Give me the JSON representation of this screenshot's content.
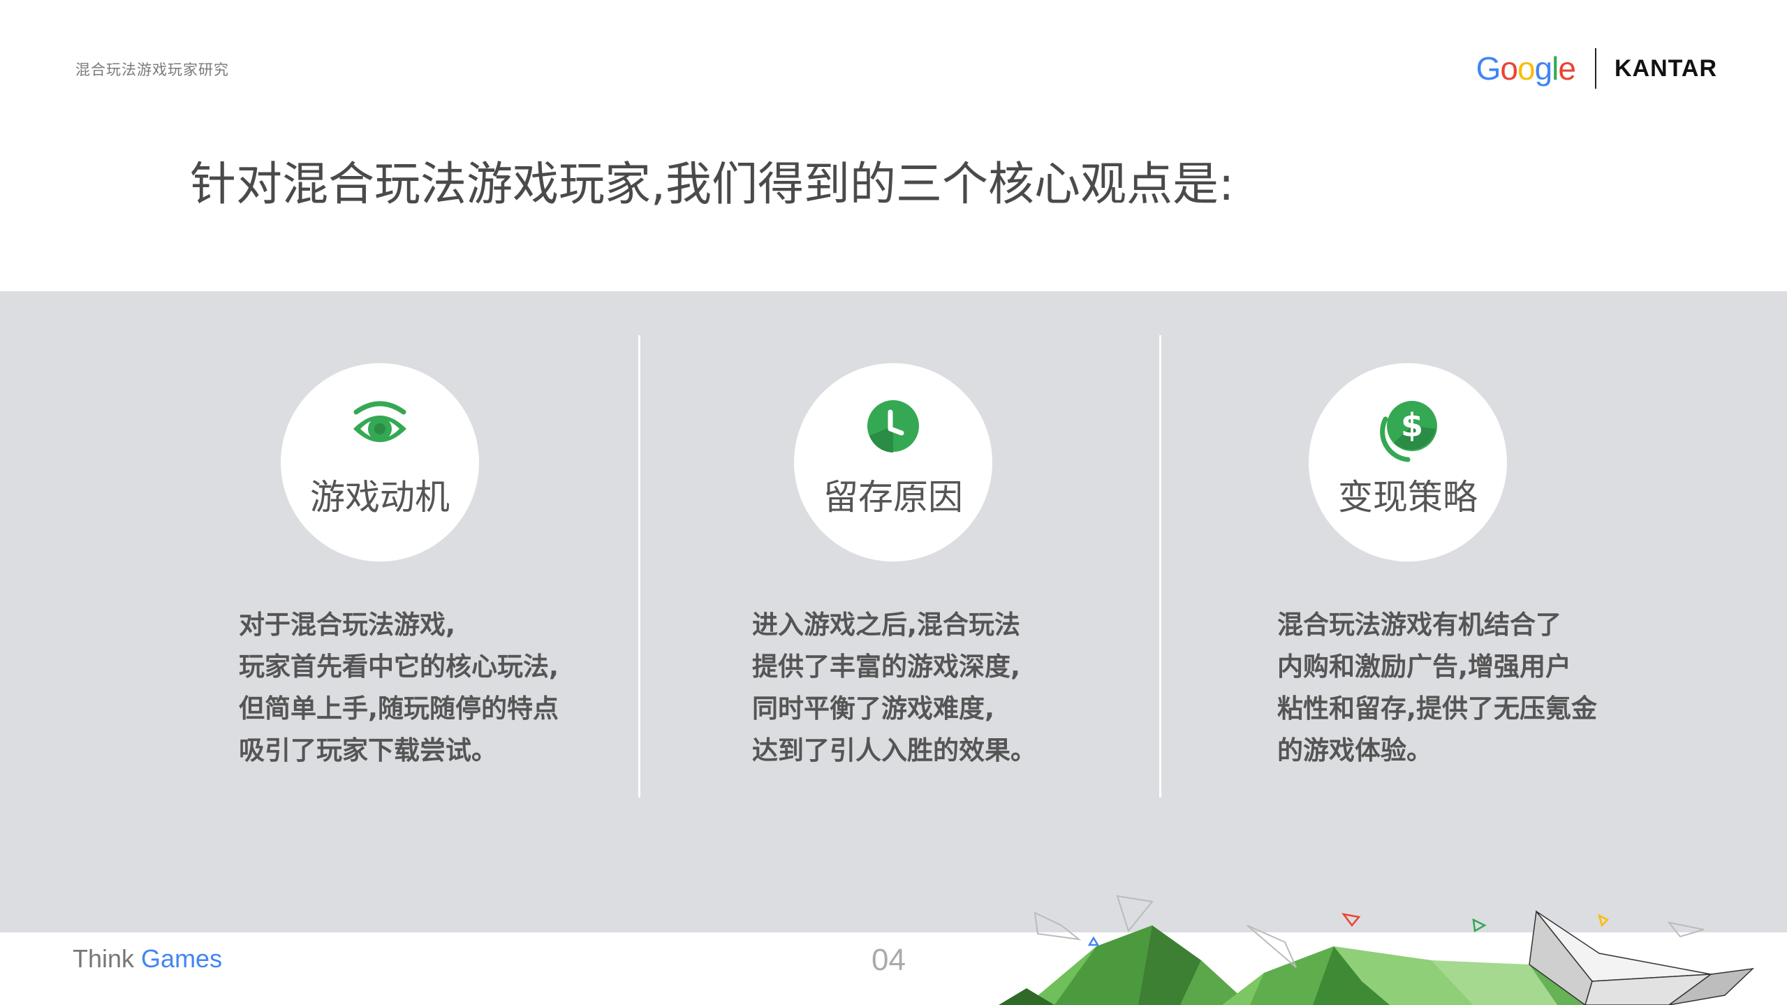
{
  "header": {
    "subtitle": "混合玩法游戏玩家研究",
    "google_letters": [
      "G",
      "o",
      "o",
      "g",
      "l",
      "e"
    ],
    "kantar": "KANTAR"
  },
  "title": "针对混合玩法游戏玩家,我们得到的三个核心观点是:",
  "columns": [
    {
      "icon": "eye-icon",
      "label": "游戏动机",
      "lines": [
        "对于混合玩法游戏,",
        "玩家首先看中它的核心玩法,",
        "但简单上手,随玩随停的特点",
        "吸引了玩家下载尝试。"
      ]
    },
    {
      "icon": "clock-icon",
      "label": "留存原因",
      "lines": [
        "进入游戏之后,混合玩法",
        "提供了丰富的游戏深度,",
        "同时平衡了游戏难度,",
        "达到了引人入胜的效果。"
      ]
    },
    {
      "icon": "dollar-coin-icon",
      "label": "变现策略",
      "lines": [
        "混合玩法游戏有机结合了",
        "内购和激励广告,增强用户",
        "粘性和留存,提供了无压氪金",
        "的游戏体验。"
      ]
    }
  ],
  "footer": {
    "think": "Think",
    "games": "Games",
    "page_number": "04"
  },
  "colors": {
    "accent_green": "#34A853",
    "panel_gray": "#dcdde1",
    "google_blue": "#4285F4"
  }
}
